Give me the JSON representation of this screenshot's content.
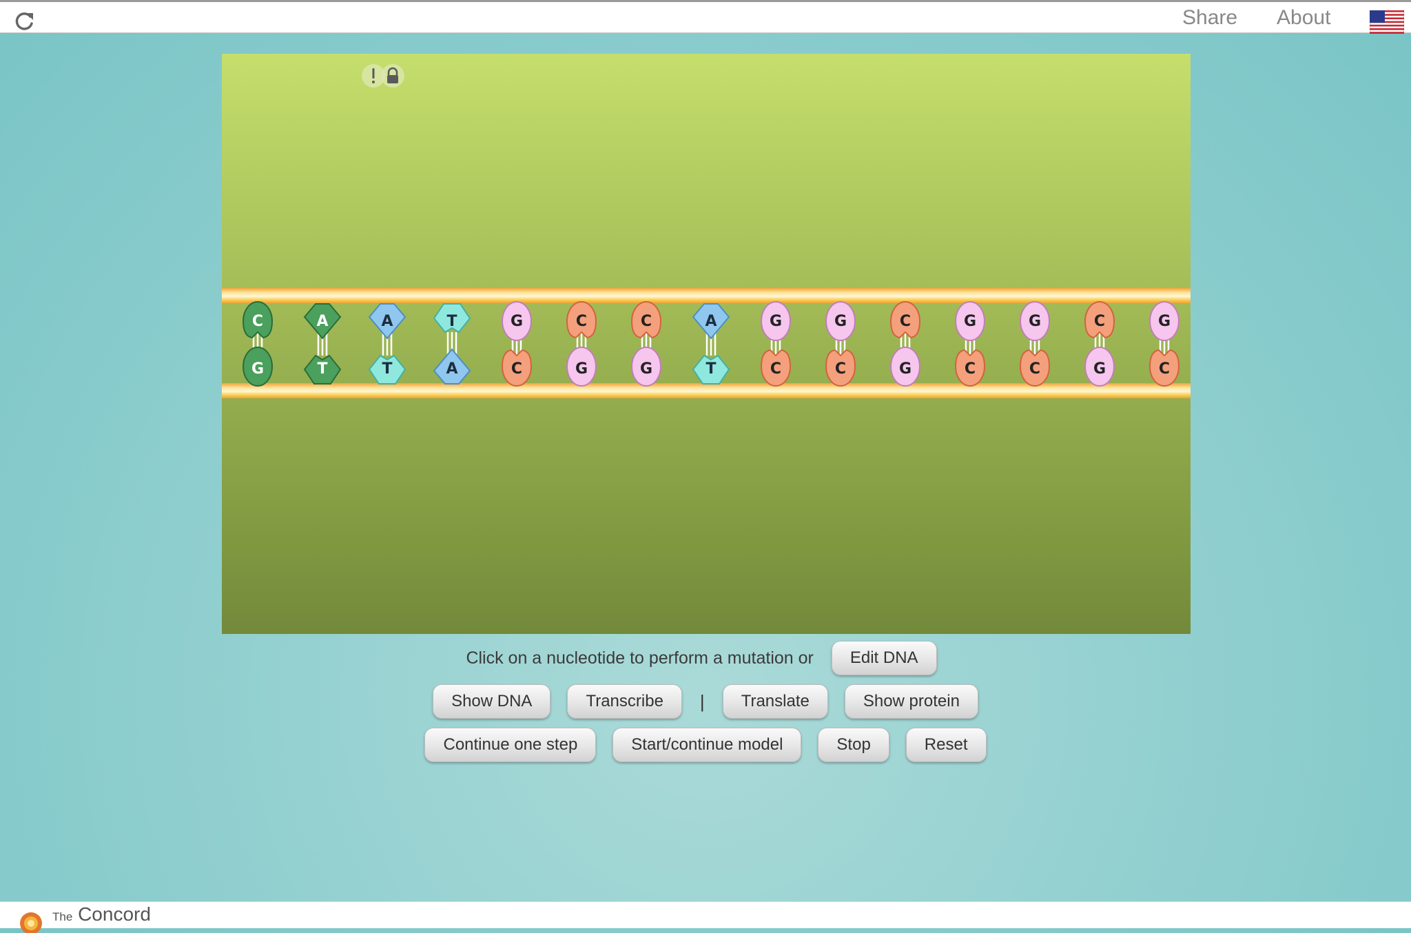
{
  "topbar": {
    "share_label": "Share",
    "about_label": "About",
    "reload_icon": "reload-icon",
    "language_flag_icon": "us-flag-icon"
  },
  "model": {
    "controls_icons": [
      "info-icon",
      "lock-icon"
    ],
    "background_top_color": "#c5de6c",
    "background_bottom_color": "#73893b",
    "backbone_color": "#f9cc4a",
    "top_strand": [
      "C",
      "A",
      "A",
      "T",
      "G",
      "C",
      "C",
      "A",
      "G",
      "G",
      "C",
      "G",
      "G",
      "C",
      "G"
    ],
    "bottom_strand": [
      "G",
      "T",
      "T",
      "A",
      "C",
      "G",
      "G",
      "T",
      "C",
      "C",
      "G",
      "C",
      "C",
      "G",
      "C"
    ],
    "nucleotide_colors": {
      "A": "#8fc7ee",
      "T": "#8fe8de",
      "G": "#f6c6ee",
      "C": "#f4a07c",
      "first_pair": "#4aa05c"
    }
  },
  "controls": {
    "prompt": "Click on a nucleotide to perform a mutation or",
    "edit_dna": "Edit DNA",
    "show_dna": "Show DNA",
    "transcribe": "Transcribe",
    "separator": "|",
    "translate": "Translate",
    "show_protein": "Show protein",
    "continue_one_step": "Continue one step",
    "start_continue_model": "Start/continue model",
    "stop": "Stop",
    "reset": "Reset"
  },
  "footer": {
    "logo_icon": "concord-logo-icon",
    "brand_prefix": "The",
    "brand_name": "Concord"
  }
}
